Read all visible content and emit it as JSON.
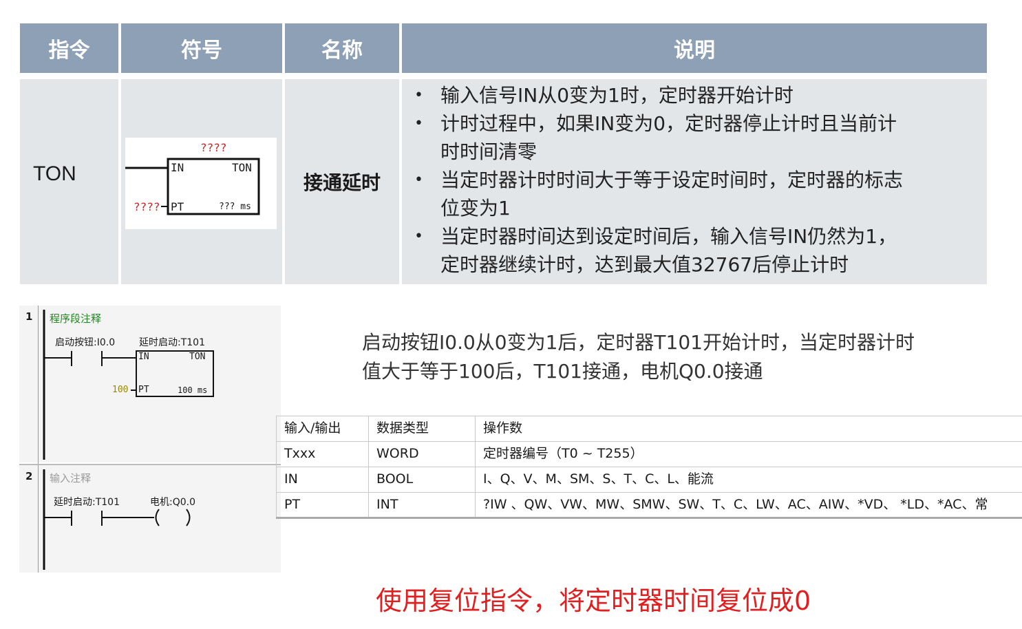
{
  "header": {
    "col_instruction": "指令",
    "col_symbol": "符号",
    "col_name": "名称",
    "col_description": "说明"
  },
  "ton_row": {
    "instruction": "TON",
    "name": "接通延时",
    "symbol": {
      "top_param": "????",
      "in_label": "IN",
      "type_label": "TON",
      "pt_param": "????",
      "pt_label": "PT",
      "time_base": "??? ms"
    },
    "description": [
      {
        "lines": [
          "输入信号IN从0变为1时，定时器开始计时"
        ]
      },
      {
        "lines": [
          "计时过程中，如果IN变为0，定时器停止计时且当前计",
          "时时间清零"
        ]
      },
      {
        "lines": [
          "当定时器计时时间大于等于设定时间时，定时器的标志",
          "位变为1"
        ]
      },
      {
        "lines": [
          "当定时器时间达到设定时间后，输入信号IN仍然为1，",
          "定时器继续计时，达到最大值32767后停止计时"
        ]
      }
    ]
  },
  "ladder": {
    "network1": {
      "number": "1",
      "comment": "程序段注释",
      "contact_label": "启动按钮:I0.0",
      "timer_label": "延时启动:T101",
      "in_label": "IN",
      "type_label": "TON",
      "pt_value": "100",
      "pt_label": "PT",
      "time_base": "100 ms"
    },
    "network2": {
      "number": "2",
      "comment": "输入注释",
      "contact_label": "延时启动:T101",
      "coil_label": "电机:Q0.0"
    }
  },
  "explanation": {
    "lines": [
      "启动按钮I0.0从0变为1后，定时器T101开始计时，当定时器计时",
      "值大于等于100后，T101接通，电机Q0.0接通"
    ]
  },
  "datatype_table": {
    "headers": [
      "输入/输出",
      "数据类型",
      "操作数"
    ],
    "rows": [
      [
        "Txxx",
        "WORD",
        "定时器编号（T0 ~ T255）"
      ],
      [
        "IN",
        "BOOL",
        "I、Q、V、M、SM、S、T、C、L、能流"
      ],
      [
        "PT",
        "INT",
        "?IW 、QW、VW、MW、SMW、SW、T、C、LW、AC、AIW、*VD、 *LD、*AC、常"
      ]
    ]
  },
  "footer_note": "使用复位指令，将定时器时间复位成0",
  "colors": {
    "header_bg": "#8da0b6",
    "row_bg": "#e3e6e9",
    "note_red": "#e02020",
    "comment_green": "#1f8a1f",
    "param_red": "#cc2222"
  }
}
